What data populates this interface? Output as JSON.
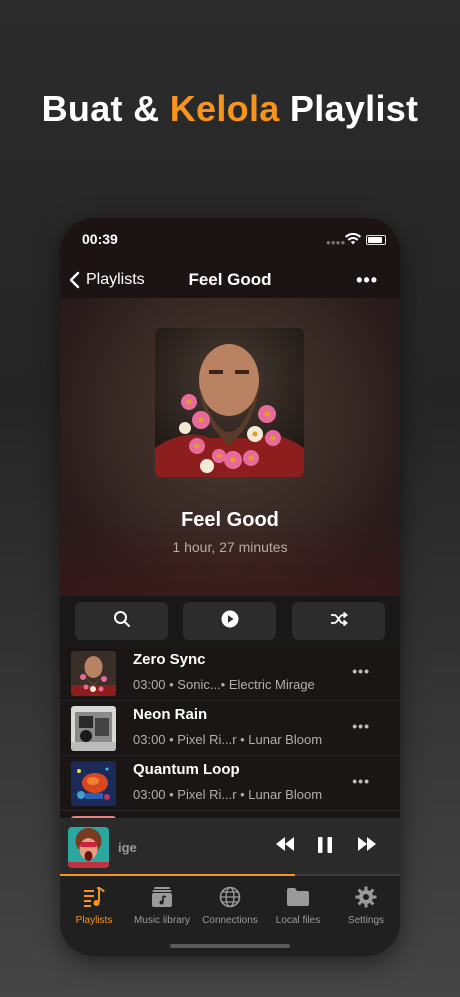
{
  "headline": {
    "part1": "Buat & ",
    "accent": "Kelola",
    "part2": " Playlist"
  },
  "status": {
    "time": "00:39"
  },
  "nav": {
    "back_label": "Playlists",
    "title": "Feel Good"
  },
  "playlist": {
    "title": "Feel Good",
    "duration": "1 hour, 27 minutes"
  },
  "tracks": [
    {
      "title": "Zero Sync",
      "subtitle": "03:00 • Sonic...• Electric Mirage"
    },
    {
      "title": "Neon Rain",
      "subtitle": "03:00 • Pixel Ri...r • Lunar Bloom"
    },
    {
      "title": "Quantum Loop",
      "subtitle": "03:00 • Pixel Ri...r • Lunar Bloom"
    }
  ],
  "now_playing": {
    "title_fragment": "ige",
    "progress": 0.69
  },
  "tabs": [
    {
      "label": "Playlists",
      "icon": "playlist-icon",
      "active": true
    },
    {
      "label": "Music library",
      "icon": "music-library-icon",
      "active": false
    },
    {
      "label": "Connections",
      "icon": "globe-icon",
      "active": false
    },
    {
      "label": "Local files",
      "icon": "folder-icon",
      "active": false
    },
    {
      "label": "Settings",
      "icon": "gear-icon",
      "active": false
    }
  ],
  "colors": {
    "accent": "#f7941d",
    "background": "#1a1a1a"
  }
}
